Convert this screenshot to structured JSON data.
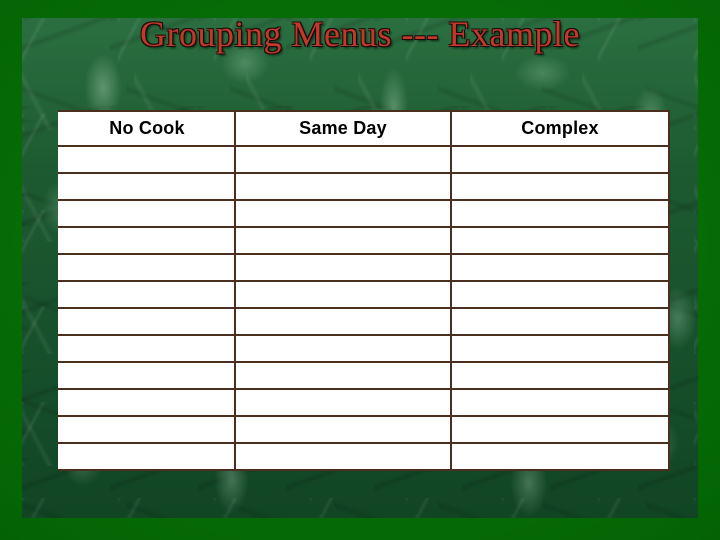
{
  "slide": {
    "title": "Grouping Menus --- Example",
    "title_color": "#c0392b",
    "background_color": "#046604",
    "panel_color": "#1d5a31"
  },
  "table": {
    "border_color": "#4a2f1e",
    "cell_background": "#ffffff",
    "columns": [
      {
        "label": "No Cook"
      },
      {
        "label": "Same Day"
      },
      {
        "label": "Complex"
      }
    ],
    "rows": [
      {
        "cells": [
          "",
          "",
          ""
        ]
      },
      {
        "cells": [
          "",
          "",
          ""
        ]
      },
      {
        "cells": [
          "",
          "",
          ""
        ]
      },
      {
        "cells": [
          "",
          "",
          ""
        ]
      },
      {
        "cells": [
          "",
          "",
          ""
        ]
      },
      {
        "cells": [
          "",
          "",
          ""
        ]
      },
      {
        "cells": [
          "",
          "",
          ""
        ]
      },
      {
        "cells": [
          "",
          "",
          ""
        ]
      },
      {
        "cells": [
          "",
          "",
          ""
        ]
      },
      {
        "cells": [
          "",
          "",
          ""
        ]
      },
      {
        "cells": [
          "",
          "",
          ""
        ]
      },
      {
        "cells": [
          "",
          "",
          ""
        ]
      }
    ]
  }
}
